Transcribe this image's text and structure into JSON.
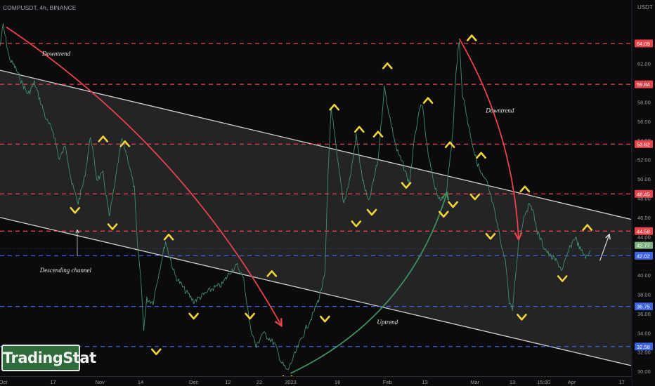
{
  "header": {
    "symbol_line": "COMPUSDT, 4h, BINANCE",
    "currency": "USDT"
  },
  "watermark": "TradingStat",
  "chart_data": {
    "type": "line",
    "title": "COMPUSDT, 4h, BINANCE",
    "ylabel": "USDT",
    "ylim": [
      29.5,
      67.0
    ],
    "grid": false,
    "y_ticks": [
      "30.00",
      "32.00",
      "34.00",
      "36.00",
      "38.00",
      "40.00",
      "42.00",
      "44.00",
      "46.00",
      "48.00",
      "50.00",
      "52.00",
      "54.00",
      "56.00",
      "58.00",
      "60.00",
      "62.00"
    ],
    "x_ticks": [
      "Oct",
      "17",
      "Nov",
      "14",
      "Dec",
      "12",
      "22",
      "2023",
      "16",
      "Feb",
      "13",
      "Mar",
      "13",
      "15:00",
      "Apr",
      "17"
    ],
    "x_tick_dates": [
      "2022-10-01",
      "2022-10-17",
      "2022-11-01",
      "2022-11-14",
      "2022-12-01",
      "2022-12-12",
      "2022-12-22",
      "2023-01-01",
      "2023-01-16",
      "2023-02-01",
      "2023-02-13",
      "2023-03-01",
      "2023-03-13",
      "2023-03-23",
      "2023-04-01",
      "2023-04-17"
    ],
    "x_range": [
      "2022-09-30",
      "2023-04-20"
    ],
    "levels": [
      {
        "value": 64.09,
        "label": "64.09",
        "color": "#e8424a",
        "style": "dashed"
      },
      {
        "value": 59.84,
        "label": "59.84",
        "color": "#e8424a",
        "style": "dashed"
      },
      {
        "value": 53.62,
        "label": "53.62",
        "color": "#e8424a",
        "style": "dashed"
      },
      {
        "value": 48.45,
        "label": "48.45",
        "color": "#e8424a",
        "style": "dashed"
      },
      {
        "value": 44.58,
        "label": "44.58",
        "color": "#e8424a",
        "style": "dashed"
      },
      {
        "value": 42.02,
        "label": "42.02",
        "color": "#3d63e0",
        "style": "dashed"
      },
      {
        "value": 36.75,
        "label": "36.75",
        "color": "#3d63e0",
        "style": "dashed"
      },
      {
        "value": 32.58,
        "label": "32.58",
        "color": "#3d63e0",
        "style": "dashed"
      }
    ],
    "current_price": {
      "value": 42.77,
      "label": "42.77",
      "color": "#7fb07f"
    },
    "series": [
      {
        "color": "#3f8f6a",
        "points": [
          [
            "2022-09-30",
            63.8
          ],
          [
            "2022-10-01",
            66.0
          ],
          [
            "2022-10-03",
            62.5
          ],
          [
            "2022-10-05",
            61.5
          ],
          [
            "2022-10-07",
            60.0
          ],
          [
            "2022-10-09",
            58.8
          ],
          [
            "2022-10-11",
            60.0
          ],
          [
            "2022-10-13",
            58.0
          ],
          [
            "2022-10-15",
            56.0
          ],
          [
            "2022-10-17",
            55.0
          ],
          [
            "2022-10-19",
            52.0
          ],
          [
            "2022-10-21",
            53.5
          ],
          [
            "2022-10-23",
            49.5
          ],
          [
            "2022-10-25",
            47.5
          ],
          [
            "2022-10-27",
            50.0
          ],
          [
            "2022-10-29",
            54.5
          ],
          [
            "2022-10-31",
            50.0
          ],
          [
            "2022-11-02",
            50.5
          ],
          [
            "2022-11-04",
            46.0
          ],
          [
            "2022-11-06",
            50.0
          ],
          [
            "2022-11-08",
            54.2
          ],
          [
            "2022-11-10",
            52.0
          ],
          [
            "2022-11-12",
            49.0
          ],
          [
            "2022-11-13",
            43.0
          ],
          [
            "2022-11-14",
            40.0
          ],
          [
            "2022-11-15",
            34.5
          ],
          [
            "2022-11-16",
            37.5
          ],
          [
            "2022-11-18",
            37.2
          ],
          [
            "2022-11-20",
            40.5
          ],
          [
            "2022-11-22",
            43.5
          ],
          [
            "2022-11-25",
            40.0
          ],
          [
            "2022-11-28",
            38.5
          ],
          [
            "2022-12-01",
            37.3
          ],
          [
            "2022-12-04",
            37.9
          ],
          [
            "2022-12-07",
            38.6
          ],
          [
            "2022-12-10",
            39.0
          ],
          [
            "2022-12-13",
            40.5
          ],
          [
            "2022-12-15",
            41.0
          ],
          [
            "2022-12-17",
            39.5
          ],
          [
            "2022-12-19",
            34.8
          ],
          [
            "2022-12-21",
            32.5
          ],
          [
            "2022-12-23",
            34.0
          ],
          [
            "2022-12-25",
            33.5
          ],
          [
            "2022-12-27",
            32.8
          ],
          [
            "2022-12-29",
            31.0
          ],
          [
            "2022-12-31",
            30.0
          ],
          [
            "2023-01-02",
            31.5
          ],
          [
            "2023-01-04",
            33.0
          ],
          [
            "2023-01-06",
            34.5
          ],
          [
            "2023-01-08",
            35.8
          ],
          [
            "2023-01-10",
            37.5
          ],
          [
            "2023-01-12",
            40.0
          ],
          [
            "2023-01-13",
            50.5
          ],
          [
            "2023-01-14",
            57.5
          ],
          [
            "2023-01-16",
            52.0
          ],
          [
            "2023-01-18",
            47.5
          ],
          [
            "2023-01-20",
            50.0
          ],
          [
            "2023-01-22",
            54.5
          ],
          [
            "2023-01-24",
            50.0
          ],
          [
            "2023-01-26",
            47.5
          ],
          [
            "2023-01-29",
            52.0
          ],
          [
            "2023-01-31",
            59.5
          ],
          [
            "2023-02-02",
            56.0
          ],
          [
            "2023-02-04",
            53.0
          ],
          [
            "2023-02-06",
            51.5
          ],
          [
            "2023-02-08",
            49.5
          ],
          [
            "2023-02-10",
            55.0
          ],
          [
            "2023-02-12",
            58.0
          ],
          [
            "2023-02-14",
            52.5
          ],
          [
            "2023-02-16",
            49.5
          ],
          [
            "2023-02-18",
            47.5
          ],
          [
            "2023-02-20",
            49.0
          ],
          [
            "2023-02-22",
            55.0
          ],
          [
            "2023-02-23",
            61.5
          ],
          [
            "2023-02-24",
            64.2
          ],
          [
            "2023-02-25",
            59.0
          ],
          [
            "2023-02-27",
            55.5
          ],
          [
            "2023-03-01",
            52.5
          ],
          [
            "2023-03-03",
            50.5
          ],
          [
            "2023-03-05",
            49.5
          ],
          [
            "2023-03-07",
            47.0
          ],
          [
            "2023-03-09",
            44.0
          ],
          [
            "2023-03-11",
            41.0
          ],
          [
            "2023-03-12",
            37.0
          ],
          [
            "2023-03-13",
            36.4
          ],
          [
            "2023-03-14",
            40.0
          ],
          [
            "2023-03-15",
            43.5
          ],
          [
            "2023-03-17",
            46.5
          ],
          [
            "2023-03-19",
            47.5
          ],
          [
            "2023-03-21",
            44.5
          ],
          [
            "2023-03-23",
            43.0
          ],
          [
            "2023-03-25",
            42.0
          ],
          [
            "2023-03-27",
            41.5
          ],
          [
            "2023-03-29",
            40.5
          ],
          [
            "2023-03-31",
            42.5
          ],
          [
            "2023-04-02",
            44.0
          ],
          [
            "2023-04-04",
            42.5
          ],
          [
            "2023-04-06",
            41.8
          ],
          [
            "2023-04-07",
            42.6
          ]
        ]
      }
    ],
    "channel": {
      "upper": [
        [
          "2022-09-30",
          61.3
        ],
        [
          "2023-04-20",
          45.8
        ]
      ],
      "lower": [
        [
          "2022-09-30",
          46.0
        ],
        [
          "2023-04-20",
          30.6
        ]
      ],
      "fill": "#3a3a3e"
    },
    "trend_arrows": [
      {
        "label": "Downtrend",
        "color": "#e8424a",
        "from": [
          "2022-10-02",
          65.8
        ],
        "to": [
          "2022-12-29",
          34.8
        ]
      },
      {
        "label": "Uptrend",
        "color": "#3e8f5f",
        "from": [
          "2023-01-01",
          29.8
        ],
        "to": [
          "2023-02-20",
          48.5
        ]
      },
      {
        "label": "Downtrend",
        "color": "#e8424a",
        "from": [
          "2023-02-24",
          64.6
        ],
        "to": [
          "2023-03-15",
          43.8
        ]
      }
    ],
    "annotations": [
      {
        "text": "Downtrend",
        "at": [
          "2022-10-18",
          62.8
        ]
      },
      {
        "text": "Descending channel",
        "at": [
          "2022-10-21",
          40.3
        ]
      },
      {
        "text": "Uptrend",
        "at": [
          "2023-02-01",
          34.9
        ]
      },
      {
        "text": "Downtrend",
        "at": [
          "2023-03-09",
          56.9
        ]
      }
    ],
    "turning_points": [
      {
        "kind": "peak",
        "at": [
          "2022-11-02",
          54.2
        ]
      },
      {
        "kind": "peak",
        "at": [
          "2022-11-09",
          53.7
        ]
      },
      {
        "kind": "trough",
        "at": [
          "2022-10-24",
          46.7
        ]
      },
      {
        "kind": "trough",
        "at": [
          "2022-11-05",
          45.0
        ]
      },
      {
        "kind": "trough",
        "at": [
          "2022-11-19",
          32.0
        ]
      },
      {
        "kind": "peak",
        "at": [
          "2022-11-23",
          44.0
        ]
      },
      {
        "kind": "trough",
        "at": [
          "2022-12-01",
          35.7
        ]
      },
      {
        "kind": "trough",
        "at": [
          "2022-12-19",
          35.7
        ]
      },
      {
        "kind": "peak",
        "at": [
          "2022-12-26",
          40.2
        ]
      },
      {
        "kind": "trough",
        "at": [
          "2023-01-12",
          35.4
        ]
      },
      {
        "kind": "trough",
        "at": [
          "2022-12-31",
          29.2
        ]
      },
      {
        "kind": "peak",
        "at": [
          "2023-01-15",
          57.5
        ]
      },
      {
        "kind": "peak",
        "at": [
          "2023-01-23",
          55.2
        ]
      },
      {
        "kind": "trough",
        "at": [
          "2023-01-22",
          45.3
        ]
      },
      {
        "kind": "trough",
        "at": [
          "2023-01-27",
          46.5
        ]
      },
      {
        "kind": "peak",
        "at": [
          "2023-01-29",
          54.7
        ]
      },
      {
        "kind": "peak",
        "at": [
          "2023-02-01",
          61.8
        ]
      },
      {
        "kind": "trough",
        "at": [
          "2023-02-07",
          49.3
        ]
      },
      {
        "kind": "peak",
        "at": [
          "2023-02-14",
          58.2
        ]
      },
      {
        "kind": "trough",
        "at": [
          "2023-02-19",
          46.3
        ]
      },
      {
        "kind": "trough",
        "at": [
          "2023-02-22",
          47.3
        ]
      },
      {
        "kind": "peak",
        "at": [
          "2023-02-21",
          53.6
        ]
      },
      {
        "kind": "peak",
        "at": [
          "2023-02-28",
          64.7
        ]
      },
      {
        "kind": "trough",
        "at": [
          "2023-03-01",
          48.1
        ]
      },
      {
        "kind": "peak",
        "at": [
          "2023-03-03",
          52.5
        ]
      },
      {
        "kind": "trough",
        "at": [
          "2023-03-06",
          44.0
        ]
      },
      {
        "kind": "trough",
        "at": [
          "2023-03-16",
          35.6
        ]
      },
      {
        "kind": "peak",
        "at": [
          "2023-03-17",
          49.0
        ]
      },
      {
        "kind": "trough",
        "at": [
          "2023-03-29",
          39.6
        ]
      },
      {
        "kind": "peak",
        "at": [
          "2023-04-06",
          45.0
        ]
      }
    ],
    "projection_arrow": {
      "color": "#d8d8d8",
      "from": [
        "2023-04-10",
        41.5
      ],
      "to": [
        "2023-04-13",
        44.2
      ]
    }
  },
  "colors": {
    "background": "#0b0b0d",
    "axis_text": "#9a9a9a",
    "price_line": "#3f8f6a",
    "resistance": "#e8424a",
    "support": "#3d63e0",
    "marker": "#f2d43a",
    "channel_line": "#d0d0d0",
    "watermark_bg": "#2f6b3b"
  }
}
